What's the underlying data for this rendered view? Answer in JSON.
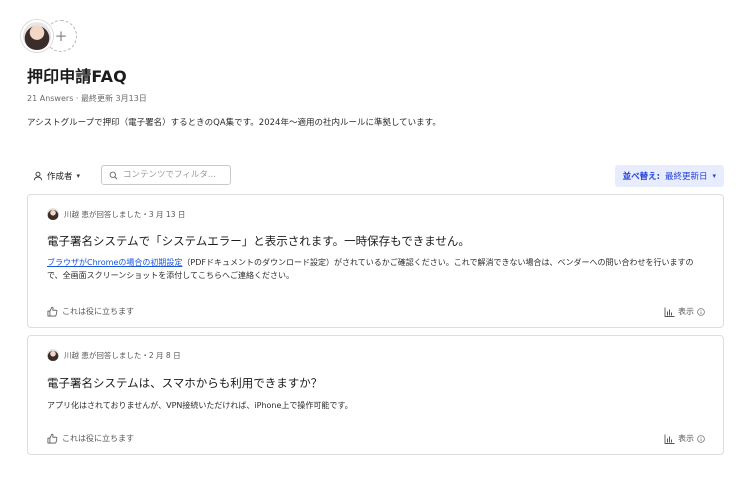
{
  "header": {
    "add_symbol": "+",
    "title": "押印申請FAQ",
    "meta": "21 Answers · 最終更新 3月13日",
    "description": "アシストグループで押印（電子署名）するときのQA集です。2024年～適用の社内ルールに準拠しています。"
  },
  "toolbar": {
    "author_label": "作成者",
    "author_caret": "▾",
    "filter_placeholder": "コンテンツでフィルタ...",
    "sort_label": "並べ替え:",
    "sort_value": "最終更新日",
    "sort_caret": "▾"
  },
  "posts": [
    {
      "answered_by": "川越 恵が回答しました・3 月 13 日",
      "question": "電子署名システムで「システムエラー」と表示されます。一時保存もできません。",
      "answer_link": "ブラウザがChromeの場合の初期設定",
      "answer_text": "（PDFドキュメントのダウンロード設定）がされているかご確認ください。これで解消できない場合は、ベンダーへの問い合わせを行いますので、全画面スクリーンショットを添付してこちらへご連絡ください。",
      "helpful_label": "これは役に立ちます",
      "view_label": "表示"
    },
    {
      "answered_by": "川越 恵が回答しました・2 月 8 日",
      "question": "電子署名システムは、スマホからも利用できますか？",
      "answer_text": "アプリ化はされておりませんが、VPN接続いただければ、iPhone上で操作可能です。",
      "helpful_label": "これは役に立ちます",
      "view_label": "表示"
    }
  ],
  "colors": {
    "accent": "#2340d8",
    "accent_bg": "#e8ecff",
    "link": "#1a56db",
    "border": "#dddddd"
  }
}
